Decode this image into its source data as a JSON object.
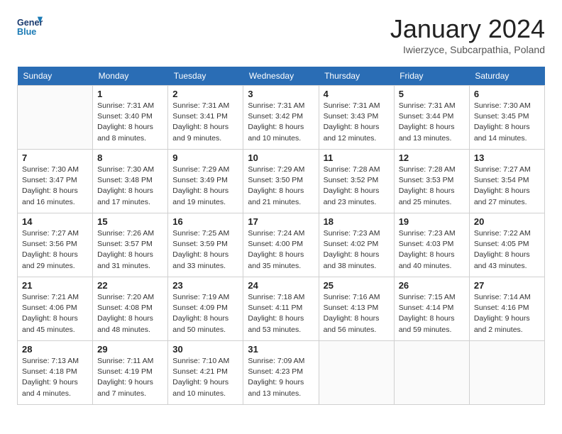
{
  "header": {
    "logo_line1": "General",
    "logo_line2": "Blue",
    "month": "January 2024",
    "location": "Iwierzyce, Subcarpathia, Poland"
  },
  "weekdays": [
    "Sunday",
    "Monday",
    "Tuesday",
    "Wednesday",
    "Thursday",
    "Friday",
    "Saturday"
  ],
  "weeks": [
    [
      {
        "day": "",
        "sunrise": "",
        "sunset": "",
        "daylight": ""
      },
      {
        "day": "1",
        "sunrise": "Sunrise: 7:31 AM",
        "sunset": "Sunset: 3:40 PM",
        "daylight": "Daylight: 8 hours and 8 minutes."
      },
      {
        "day": "2",
        "sunrise": "Sunrise: 7:31 AM",
        "sunset": "Sunset: 3:41 PM",
        "daylight": "Daylight: 8 hours and 9 minutes."
      },
      {
        "day": "3",
        "sunrise": "Sunrise: 7:31 AM",
        "sunset": "Sunset: 3:42 PM",
        "daylight": "Daylight: 8 hours and 10 minutes."
      },
      {
        "day": "4",
        "sunrise": "Sunrise: 7:31 AM",
        "sunset": "Sunset: 3:43 PM",
        "daylight": "Daylight: 8 hours and 12 minutes."
      },
      {
        "day": "5",
        "sunrise": "Sunrise: 7:31 AM",
        "sunset": "Sunset: 3:44 PM",
        "daylight": "Daylight: 8 hours and 13 minutes."
      },
      {
        "day": "6",
        "sunrise": "Sunrise: 7:30 AM",
        "sunset": "Sunset: 3:45 PM",
        "daylight": "Daylight: 8 hours and 14 minutes."
      }
    ],
    [
      {
        "day": "7",
        "sunrise": "Sunrise: 7:30 AM",
        "sunset": "Sunset: 3:47 PM",
        "daylight": "Daylight: 8 hours and 16 minutes."
      },
      {
        "day": "8",
        "sunrise": "Sunrise: 7:30 AM",
        "sunset": "Sunset: 3:48 PM",
        "daylight": "Daylight: 8 hours and 17 minutes."
      },
      {
        "day": "9",
        "sunrise": "Sunrise: 7:29 AM",
        "sunset": "Sunset: 3:49 PM",
        "daylight": "Daylight: 8 hours and 19 minutes."
      },
      {
        "day": "10",
        "sunrise": "Sunrise: 7:29 AM",
        "sunset": "Sunset: 3:50 PM",
        "daylight": "Daylight: 8 hours and 21 minutes."
      },
      {
        "day": "11",
        "sunrise": "Sunrise: 7:28 AM",
        "sunset": "Sunset: 3:52 PM",
        "daylight": "Daylight: 8 hours and 23 minutes."
      },
      {
        "day": "12",
        "sunrise": "Sunrise: 7:28 AM",
        "sunset": "Sunset: 3:53 PM",
        "daylight": "Daylight: 8 hours and 25 minutes."
      },
      {
        "day": "13",
        "sunrise": "Sunrise: 7:27 AM",
        "sunset": "Sunset: 3:54 PM",
        "daylight": "Daylight: 8 hours and 27 minutes."
      }
    ],
    [
      {
        "day": "14",
        "sunrise": "Sunrise: 7:27 AM",
        "sunset": "Sunset: 3:56 PM",
        "daylight": "Daylight: 8 hours and 29 minutes."
      },
      {
        "day": "15",
        "sunrise": "Sunrise: 7:26 AM",
        "sunset": "Sunset: 3:57 PM",
        "daylight": "Daylight: 8 hours and 31 minutes."
      },
      {
        "day": "16",
        "sunrise": "Sunrise: 7:25 AM",
        "sunset": "Sunset: 3:59 PM",
        "daylight": "Daylight: 8 hours and 33 minutes."
      },
      {
        "day": "17",
        "sunrise": "Sunrise: 7:24 AM",
        "sunset": "Sunset: 4:00 PM",
        "daylight": "Daylight: 8 hours and 35 minutes."
      },
      {
        "day": "18",
        "sunrise": "Sunrise: 7:23 AM",
        "sunset": "Sunset: 4:02 PM",
        "daylight": "Daylight: 8 hours and 38 minutes."
      },
      {
        "day": "19",
        "sunrise": "Sunrise: 7:23 AM",
        "sunset": "Sunset: 4:03 PM",
        "daylight": "Daylight: 8 hours and 40 minutes."
      },
      {
        "day": "20",
        "sunrise": "Sunrise: 7:22 AM",
        "sunset": "Sunset: 4:05 PM",
        "daylight": "Daylight: 8 hours and 43 minutes."
      }
    ],
    [
      {
        "day": "21",
        "sunrise": "Sunrise: 7:21 AM",
        "sunset": "Sunset: 4:06 PM",
        "daylight": "Daylight: 8 hours and 45 minutes."
      },
      {
        "day": "22",
        "sunrise": "Sunrise: 7:20 AM",
        "sunset": "Sunset: 4:08 PM",
        "daylight": "Daylight: 8 hours and 48 minutes."
      },
      {
        "day": "23",
        "sunrise": "Sunrise: 7:19 AM",
        "sunset": "Sunset: 4:09 PM",
        "daylight": "Daylight: 8 hours and 50 minutes."
      },
      {
        "day": "24",
        "sunrise": "Sunrise: 7:18 AM",
        "sunset": "Sunset: 4:11 PM",
        "daylight": "Daylight: 8 hours and 53 minutes."
      },
      {
        "day": "25",
        "sunrise": "Sunrise: 7:16 AM",
        "sunset": "Sunset: 4:13 PM",
        "daylight": "Daylight: 8 hours and 56 minutes."
      },
      {
        "day": "26",
        "sunrise": "Sunrise: 7:15 AM",
        "sunset": "Sunset: 4:14 PM",
        "daylight": "Daylight: 8 hours and 59 minutes."
      },
      {
        "day": "27",
        "sunrise": "Sunrise: 7:14 AM",
        "sunset": "Sunset: 4:16 PM",
        "daylight": "Daylight: 9 hours and 2 minutes."
      }
    ],
    [
      {
        "day": "28",
        "sunrise": "Sunrise: 7:13 AM",
        "sunset": "Sunset: 4:18 PM",
        "daylight": "Daylight: 9 hours and 4 minutes."
      },
      {
        "day": "29",
        "sunrise": "Sunrise: 7:11 AM",
        "sunset": "Sunset: 4:19 PM",
        "daylight": "Daylight: 9 hours and 7 minutes."
      },
      {
        "day": "30",
        "sunrise": "Sunrise: 7:10 AM",
        "sunset": "Sunset: 4:21 PM",
        "daylight": "Daylight: 9 hours and 10 minutes."
      },
      {
        "day": "31",
        "sunrise": "Sunrise: 7:09 AM",
        "sunset": "Sunset: 4:23 PM",
        "daylight": "Daylight: 9 hours and 13 minutes."
      },
      {
        "day": "",
        "sunrise": "",
        "sunset": "",
        "daylight": ""
      },
      {
        "day": "",
        "sunrise": "",
        "sunset": "",
        "daylight": ""
      },
      {
        "day": "",
        "sunrise": "",
        "sunset": "",
        "daylight": ""
      }
    ]
  ]
}
